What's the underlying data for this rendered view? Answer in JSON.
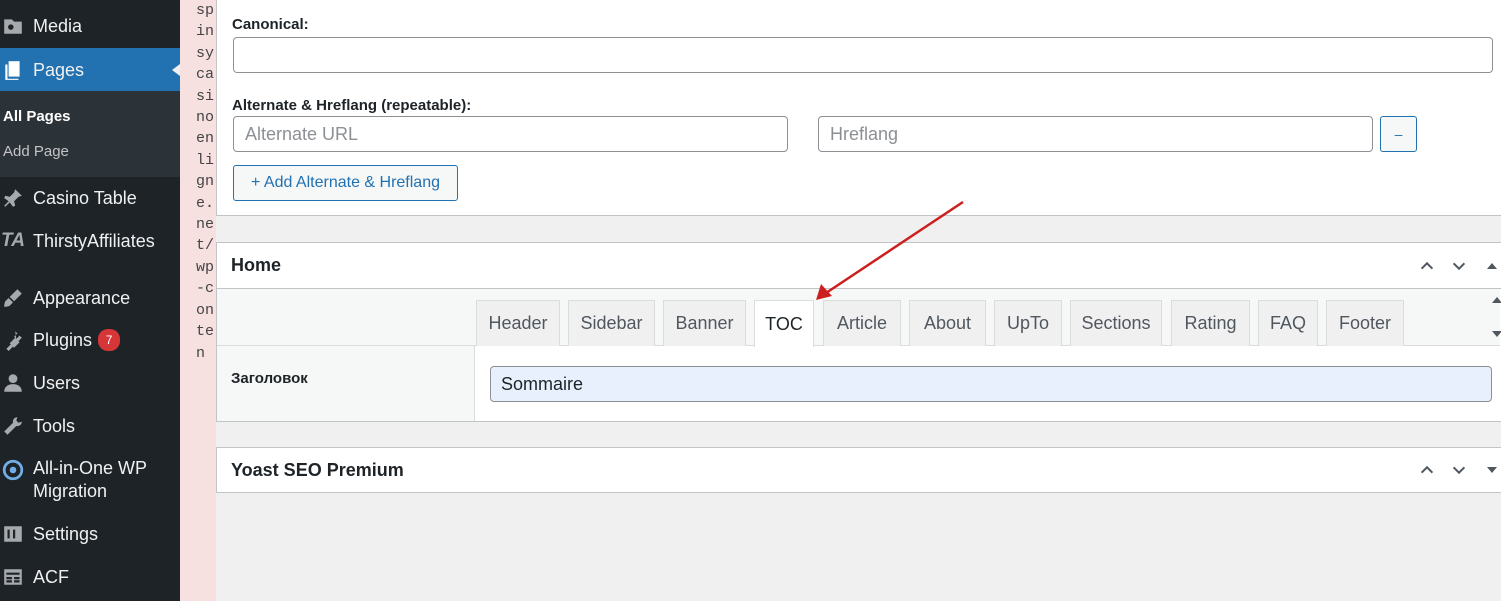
{
  "sidebar": {
    "items": [
      {
        "label": "Media",
        "icon": "media-icon"
      },
      {
        "label": "Pages",
        "icon": "pages-icon"
      },
      {
        "label": "Casino Table",
        "icon": "pin-icon"
      },
      {
        "label": "ThirstyAffiliates",
        "icon": "ta-icon"
      },
      {
        "label": "Appearance",
        "icon": "brush-icon"
      },
      {
        "label": "Plugins",
        "icon": "plugin-icon",
        "badge": "7"
      },
      {
        "label": "Users",
        "icon": "user-icon"
      },
      {
        "label": "Tools",
        "icon": "wrench-icon"
      },
      {
        "label": "All-in-One WP",
        "label2": "Migration",
        "icon": "migration-icon"
      },
      {
        "label": "Settings",
        "icon": "settings-icon"
      },
      {
        "label": "ACF",
        "icon": "acf-icon"
      }
    ],
    "submenu": {
      "all_pages": "All Pages",
      "add_page": "Add Page"
    },
    "accent": "#2271b1",
    "badge_color": "#d63638"
  },
  "strip_text": "spinsycasinoenligne.net/wp-conten",
  "seo_panel": {
    "canonical_label": "Canonical:",
    "canonical_value": "",
    "alternate_label": "Alternate & Hreflang (repeatable):",
    "alternate_placeholder": "Alternate URL",
    "hreflang_placeholder": "Hreflang",
    "remove_button": "–",
    "add_button": "+ Add Alternate & Hreflang"
  },
  "home_box": {
    "title": "Home",
    "tabs": [
      "Header",
      "Sidebar",
      "Banner",
      "TOC",
      "Article",
      "About",
      "UpTo",
      "Sections",
      "Rating",
      "FAQ",
      "Footer"
    ],
    "active_tab": "TOC",
    "field_label": "Заголовок",
    "field_value": "Sommaire"
  },
  "yoast_box": {
    "title": "Yoast SEO Premium"
  },
  "annotation_color": "#cc1f1f"
}
